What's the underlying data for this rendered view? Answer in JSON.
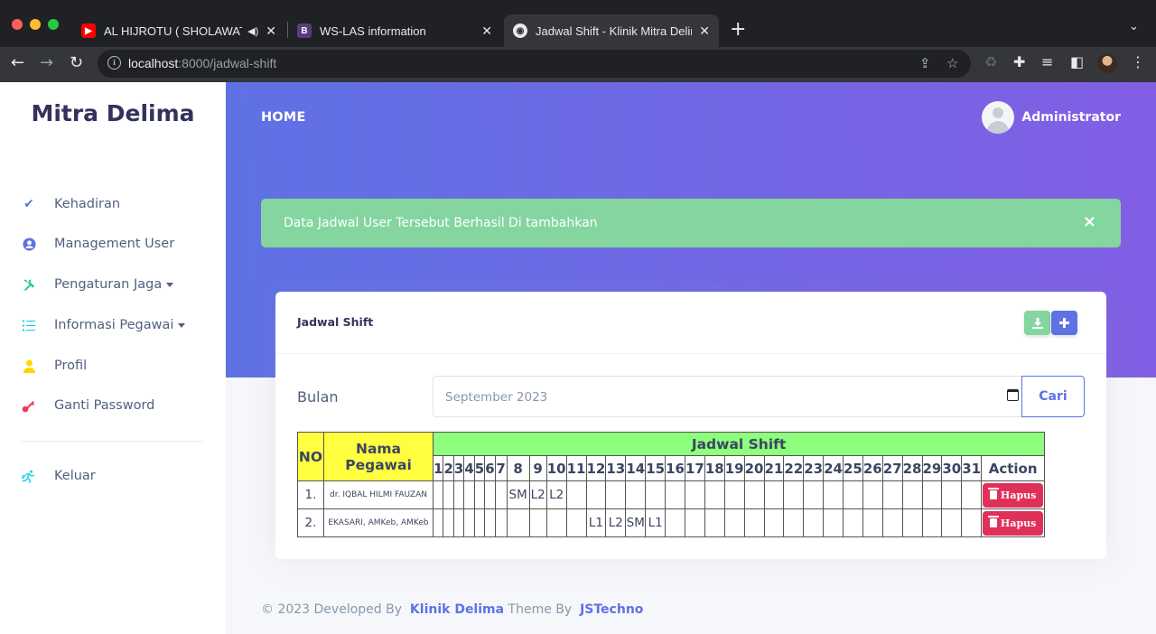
{
  "browser": {
    "tabs": [
      {
        "title": "AL HIJROTU ( SHOLAWAT",
        "favicon": "youtube-icon"
      },
      {
        "title": "WS-LAS information",
        "favicon": "bootstrap-icon"
      },
      {
        "title": "Jadwal Shift - Klinik Mitra Delim",
        "favicon": "globe-icon"
      }
    ],
    "url_host": "localhost",
    "url_path": ":8000/jadwal-shift"
  },
  "sidebar": {
    "brand": "Mitra Delima",
    "items": [
      {
        "label": "Kehadiran",
        "icon": "check-icon",
        "color": "#5e72e4"
      },
      {
        "label": "Management User",
        "icon": "user-circle-icon",
        "color": "#5e72e4"
      },
      {
        "label": "Pengaturan Jaga",
        "icon": "tools-icon",
        "color": "#2dce89"
      },
      {
        "label": "Informasi Pegawai",
        "icon": "list-icon",
        "color": "#11cdef"
      },
      {
        "label": "Profil",
        "icon": "user-icon",
        "color": "#ffd600"
      },
      {
        "label": "Ganti Password",
        "icon": "key-icon",
        "color": "#f5365c"
      },
      {
        "label": "Keluar",
        "icon": "running-icon",
        "color": "#11cdef"
      }
    ]
  },
  "header": {
    "home": "HOME",
    "user_name": "Administrator"
  },
  "alert": {
    "message": "Data Jadwal User Tersebut Berhasil Di tambahkan",
    "close": "×"
  },
  "card": {
    "title": "Jadwal Shift",
    "filter_label": "Bulan",
    "month_value": "September  2023",
    "search_button": "Cari"
  },
  "table": {
    "col_no": "NO",
    "col_name": "Nama Pegawai",
    "col_group": "Jadwal Shift",
    "col_action": "Action",
    "days": [
      "1",
      "2",
      "3",
      "4",
      "5",
      "6",
      "7",
      "8",
      "9",
      "10",
      "11",
      "12",
      "13",
      "14",
      "15",
      "16",
      "17",
      "18",
      "19",
      "20",
      "21",
      "22",
      "23",
      "24",
      "25",
      "26",
      "27",
      "28",
      "29",
      "30",
      "31"
    ],
    "rows": [
      {
        "no": "1.",
        "name": "dr. IQBAL HILMI FAUZAN",
        "shifts": [
          "",
          "",
          "",
          "",
          "",
          "",
          "",
          "SM",
          "L2",
          "L2",
          "",
          "",
          "",
          "",
          "",
          "",
          "",
          "",
          "",
          "",
          "",
          "",
          "",
          "",
          "",
          "",
          "",
          "",
          "",
          "",
          ""
        ],
        "action": "Hapus"
      },
      {
        "no": "2.",
        "name": "EKASARI, AMKeb, AMKeb",
        "shifts": [
          "",
          "",
          "",
          "",
          "",
          "",
          "",
          "",
          "",
          "",
          "",
          "L1",
          "L2",
          "SM",
          "L1",
          "",
          "",
          "",
          "",
          "",
          "",
          "",
          "",
          "",
          "",
          "",
          "",
          "",
          "",
          "",
          ""
        ],
        "action": "Hapus"
      }
    ]
  },
  "footer": {
    "prefix": "© 2023 Developed By",
    "link1": "Klinik Delima",
    "middle": "Theme By",
    "link2": "JSTechno"
  }
}
